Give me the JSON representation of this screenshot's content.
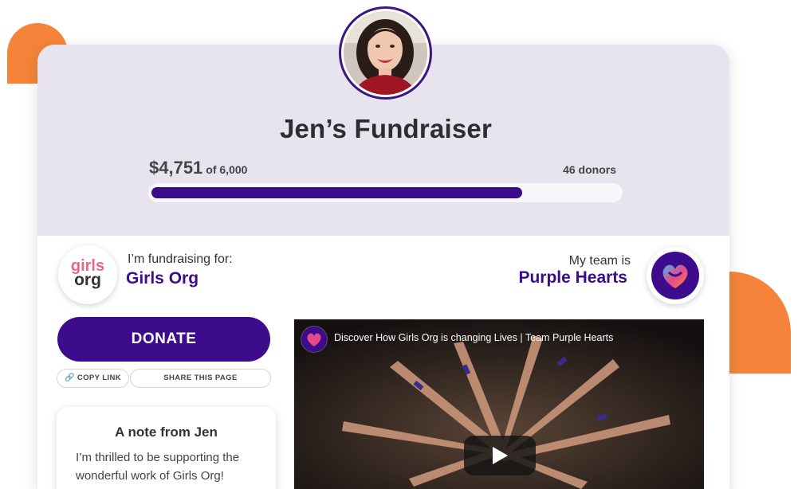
{
  "campaign": {
    "title": "Jen’s Fundraiser",
    "raised": "$4,751",
    "goal_text": "of 6,000",
    "progress_fraction": 0.7918,
    "donors_text": "46 donors"
  },
  "organization": {
    "fundraising_label": "I’m fundraising for:",
    "name": "Girls Org",
    "logo_line1": "girls",
    "logo_line2": "org"
  },
  "team": {
    "label": "My team is",
    "name": "Purple Hearts"
  },
  "actions": {
    "donate_label": "DONATE",
    "copy_link_label": "COPY LINK",
    "share_label": "SHARE THIS PAGE"
  },
  "note": {
    "title": "A note from Jen",
    "body": "I’m thrilled to be supporting the wonderful work of Girls Org!"
  },
  "video": {
    "title": "Discover How Girls Org is changing Lives | Team Purple Hearts"
  },
  "icons": {
    "copy": "link-icon",
    "play": "play-icon",
    "team": "heart-icon",
    "avatar": "avatar"
  },
  "colors": {
    "brand": "#3d0c8c",
    "accent_orange": "#f5843a",
    "hero_bg": "#e7e4f0"
  }
}
